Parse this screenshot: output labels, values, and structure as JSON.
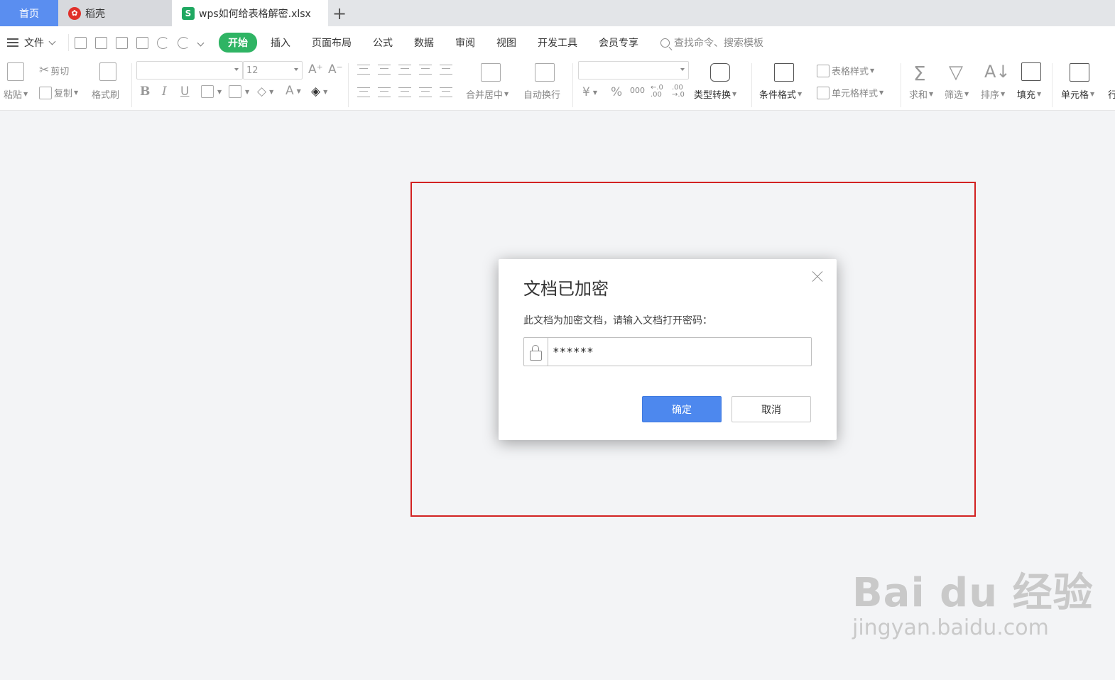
{
  "tabs": {
    "home": "首页",
    "daoke": "稻壳",
    "file": "wps如何给表格解密.xlsx",
    "add": "+"
  },
  "menu": {
    "file": "文件",
    "items": [
      "开始",
      "插入",
      "页面布局",
      "公式",
      "数据",
      "审阅",
      "视图",
      "开发工具",
      "会员专享"
    ],
    "active": "开始",
    "search_placeholder": "查找命令、搜索模板"
  },
  "ribbon": {
    "paste": "粘贴",
    "cut": "剪切",
    "copy": "复制",
    "format_painter": "格式刷",
    "font_name": "",
    "font_size": "12",
    "merge_center": "合并居中",
    "auto_wrap": "自动换行",
    "number_format": "",
    "currency": "¥",
    "percent": "%",
    "thousands": "000",
    "inc_decimal": "←.0 .00",
    "dec_decimal": ".00 →.0",
    "type_convert": "类型转换",
    "cond_format": "条件格式",
    "table_style": "表格样式",
    "cell_style": "单元格样式",
    "sum": "求和",
    "filter": "筛选",
    "sort": "排序",
    "fill": "填充",
    "cell": "单元格",
    "row_col": "行"
  },
  "dialog": {
    "title": "文档已加密",
    "message": "此文档为加密文档，请输入文档打开密码：",
    "password_value": "******",
    "ok": "确定",
    "cancel": "取消"
  },
  "watermark": {
    "top": "Bai du 经验",
    "bottom": "jingyan.baidu.com"
  },
  "colors": {
    "active_tab": "#5a8ef0",
    "start_menu": "#2fb464",
    "ok_button": "#4d88ee",
    "highlight": "#d22222"
  }
}
